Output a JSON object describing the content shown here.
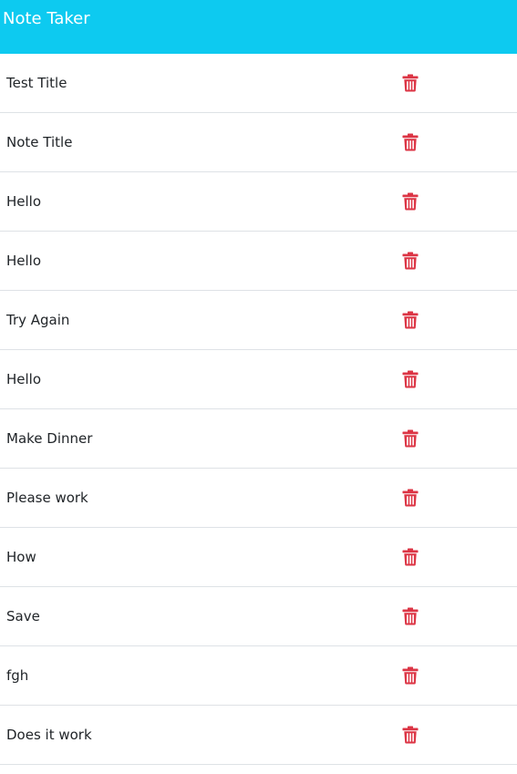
{
  "app": {
    "brand": "Note Taker"
  },
  "colors": {
    "navbar": "#0dcaf0",
    "delete_icon": "#dc3545",
    "divider": "#dee2e6"
  },
  "notes": [
    {
      "title": "Test Title",
      "icon": "trash-icon"
    },
    {
      "title": "Note Title",
      "icon": "trash-icon"
    },
    {
      "title": "Hello",
      "icon": "trash-icon"
    },
    {
      "title": "Hello",
      "icon": "trash-icon"
    },
    {
      "title": "Try Again",
      "icon": "trash-icon"
    },
    {
      "title": "Hello",
      "icon": "trash-icon"
    },
    {
      "title": "Make Dinner",
      "icon": "trash-icon"
    },
    {
      "title": "Please work",
      "icon": "trash-icon"
    },
    {
      "title": "How",
      "icon": "trash-icon"
    },
    {
      "title": "Save",
      "icon": "trash-icon"
    },
    {
      "title": "fgh",
      "icon": "trash-icon"
    },
    {
      "title": "Does it work",
      "icon": "trash-icon"
    }
  ]
}
